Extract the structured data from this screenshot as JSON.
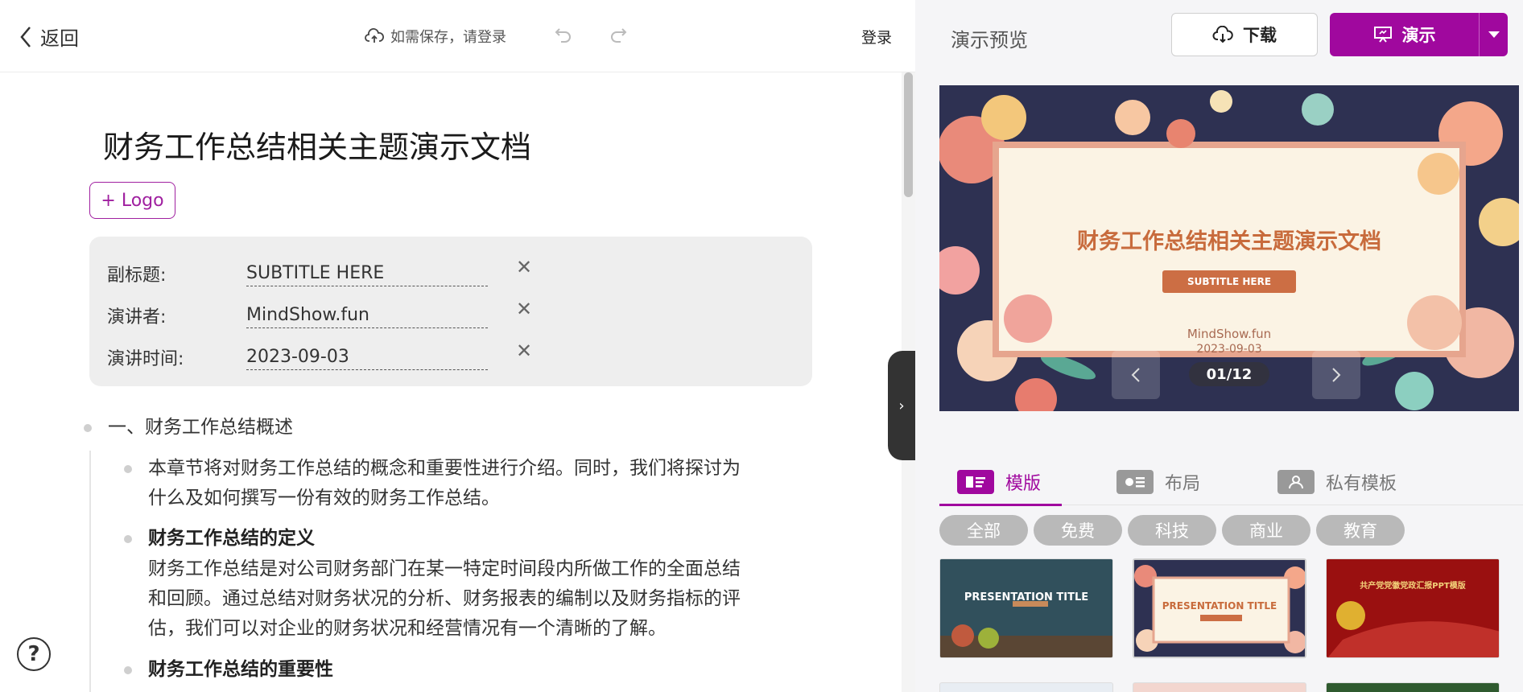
{
  "editor": {
    "back_label": "返回",
    "save_hint": "如需保存，请登录",
    "login_label": "登录",
    "logo_button": "+ Logo",
    "doc_title": "财务工作总结相关主题演示文档",
    "meta": [
      {
        "label": "副标题:",
        "value": "SUBTITLE HERE"
      },
      {
        "label": "演讲者:",
        "value": "MindShow.fun"
      },
      {
        "label": "演讲时间:",
        "value": "2023-09-03"
      }
    ],
    "clear_symbol": "✕",
    "outline": {
      "section_title": "一、财务工作总结概述",
      "intro_line1": "本章节将对财务工作总结的概念和重要性进行介绍。同时，我们将探讨为",
      "intro_line2": "什么及如何撰写一份有效的财务工作总结。",
      "def_heading": "财务工作总结的定义",
      "def_line1": "财务工作总结是对公司财务部门在某一特定时间段内所做工作的全面总结",
      "def_line2": "和回顾。通过总结对财务状况的分析、财务报表的编制以及财务指标的评",
      "def_line3": "估，我们可以对企业的财务状况和经营情况有一个清晰的了解。",
      "imp_heading": "财务工作总结的重要性"
    },
    "help_symbol": "?",
    "collapse_symbol": "›"
  },
  "preview": {
    "label": "演示预览",
    "download_label": "下载",
    "present_label": "演示",
    "slide": {
      "title": "财务工作总结相关主题演示文档",
      "subtitle": "SUBTITLE HERE",
      "presenter": "MindShow.fun",
      "date": "2023-09-03",
      "counter": "01/12"
    },
    "tabs": [
      {
        "label": "模版",
        "icon": "template-icon",
        "active": true
      },
      {
        "label": "布局",
        "icon": "layout-icon",
        "active": false
      },
      {
        "label": "私有模板",
        "icon": "private-template-icon",
        "active": false
      }
    ],
    "filters": [
      "全部",
      "免费",
      "科技",
      "商业",
      "教育"
    ],
    "thumbnails": [
      {
        "title": "PRESENTATION TITLE"
      },
      {
        "title": "PRESENTATION TITLE"
      },
      {
        "title": "共产党党徽党政汇报PPT模版"
      }
    ]
  },
  "colors": {
    "accent": "#a0089e",
    "chip": "#b9b9b9",
    "slide_title": "#c86b3c"
  }
}
